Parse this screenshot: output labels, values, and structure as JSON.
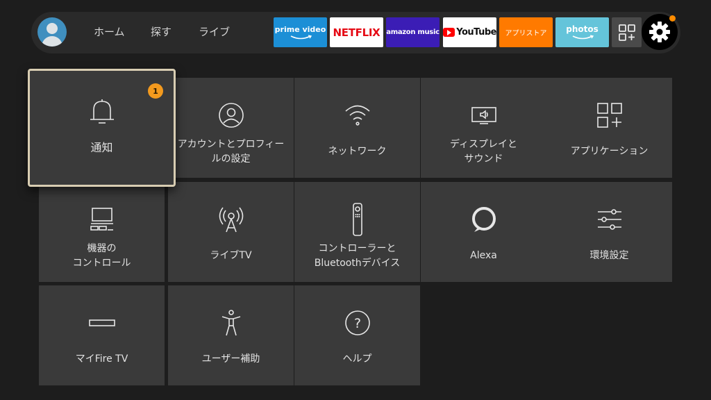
{
  "nav": {
    "avatar": "user-avatar",
    "items": [
      "ホーム",
      "探す",
      "ライブ"
    ]
  },
  "apps": {
    "prime_video": "prime video",
    "netflix": "NETFLIX",
    "amazon_music": "amazon music",
    "youtube": "YouTube",
    "appstore": "アプリストア",
    "photos": "photos",
    "all_apps_icon": "apps-grid-plus-icon",
    "settings_icon": "gear-icon"
  },
  "colors": {
    "focus_border": "#d8cdb2",
    "badge": "#f39a1e",
    "tile": "#3a3a3a",
    "background": "#1d1d1d"
  },
  "tiles": [
    {
      "label": "通知",
      "icon": "bell-icon",
      "badge": "1"
    },
    {
      "label": "アカウントとプロフィールの設定",
      "line1": "アカウントとプロフィー",
      "line2": "ルの設定",
      "icon": "profile-icon"
    },
    {
      "label": "ネットワーク",
      "icon": "wifi-icon"
    },
    {
      "label": "ディスプレイとサウンド",
      "line1": "ディスプレイと",
      "line2": "サウンド",
      "icon": "tv-speaker-icon"
    },
    {
      "label": "アプリケーション",
      "icon": "apps-grid-plus-icon"
    },
    {
      "label": "機器のコントロール",
      "line1": "機器の",
      "line2": "コントロール",
      "icon": "tv-devices-icon"
    },
    {
      "label": "ライブTV",
      "icon": "antenna-icon"
    },
    {
      "label": "コントローラーとBluetoothデバイス",
      "line1": "コントローラーと",
      "line2": "Bluetoothデバイス",
      "icon": "remote-icon"
    },
    {
      "label": "Alexa",
      "icon": "alexa-icon"
    },
    {
      "label": "環境設定",
      "icon": "sliders-icon"
    },
    {
      "label": "マイFire TV",
      "icon": "fire-tv-device-icon"
    },
    {
      "label": "ユーザー補助",
      "icon": "accessibility-icon"
    },
    {
      "label": "ヘルプ",
      "icon": "help-icon"
    }
  ]
}
